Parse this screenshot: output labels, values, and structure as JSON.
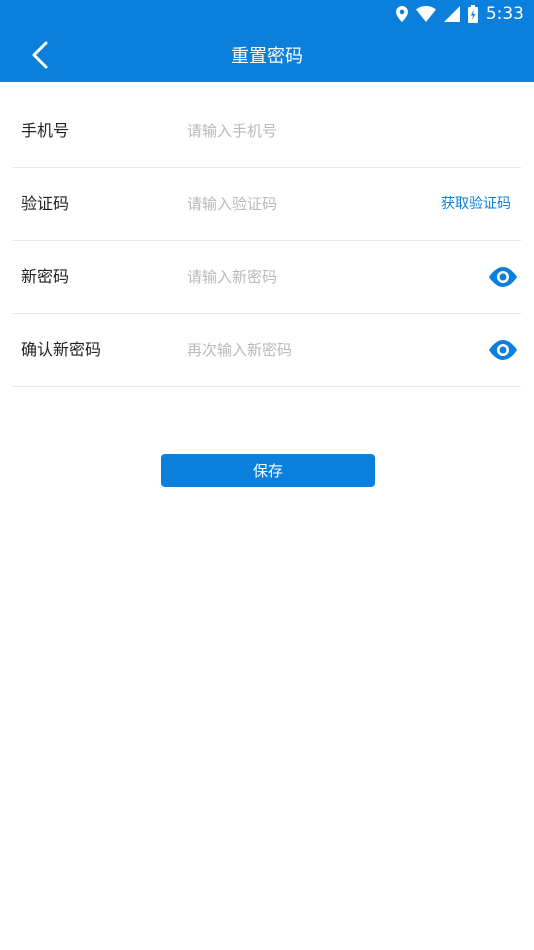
{
  "status_bar": {
    "time": "5:33",
    "icons": [
      "location-icon",
      "wifi-icon",
      "signal-icon",
      "battery-icon"
    ]
  },
  "app_bar": {
    "title": "重置密码",
    "back_icon": "chevron-left-icon"
  },
  "form": {
    "phone": {
      "label": "手机号",
      "placeholder": "请输入手机号",
      "value": ""
    },
    "code": {
      "label": "验证码",
      "placeholder": "请输入验证码",
      "value": "",
      "action_label": "获取验证码"
    },
    "new_password": {
      "label": "新密码",
      "placeholder": "请输入新密码",
      "value": "",
      "toggle_icon": "eye-icon"
    },
    "confirm_password": {
      "label": "确认新密码",
      "placeholder": "再次输入新密码",
      "value": "",
      "toggle_icon": "eye-icon"
    }
  },
  "save_button": {
    "label": "保存"
  },
  "colors": {
    "primary": "#0b7fdc",
    "label_text": "#222222",
    "placeholder": "#b9b9b9",
    "divider": "#e6e6e6"
  }
}
